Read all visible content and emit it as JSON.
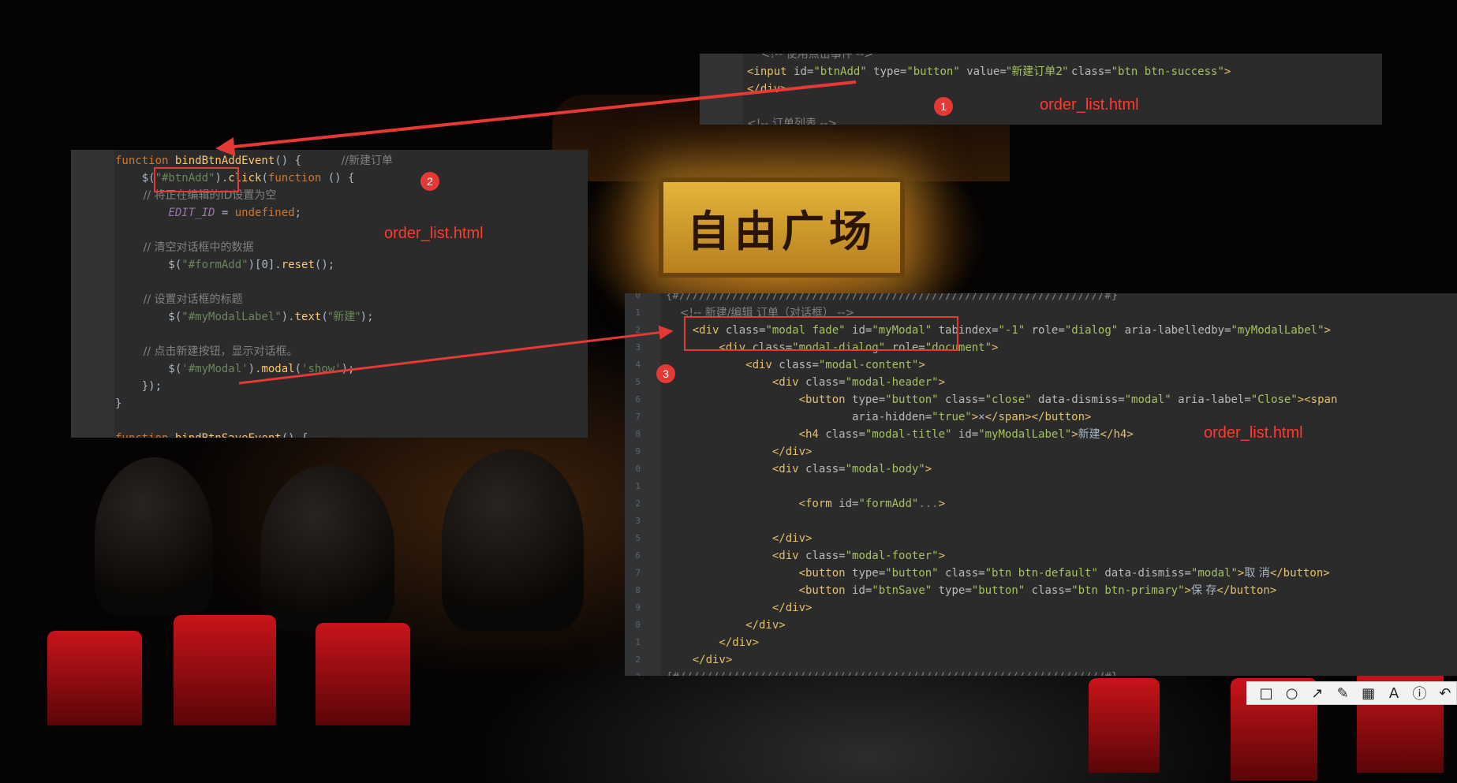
{
  "background": {
    "plaque_text": "自由广场"
  },
  "panel1": {
    "lines": [
      {
        "parts": [
          [
            "cm",
            "    <!-- 使用点击事件 -->"
          ]
        ]
      },
      {
        "parts": [
          [
            "tag",
            "<input "
          ],
          [
            "attr",
            "id="
          ],
          [
            "val",
            "\"btnAdd\" "
          ],
          [
            "attr",
            "type="
          ],
          [
            "val",
            "\"button\" "
          ],
          [
            "attr",
            "value="
          ],
          [
            "val",
            "\"新建订单2\" "
          ],
          [
            "attr",
            "class="
          ],
          [
            "val",
            "\"btn btn-success\""
          ],
          [
            "tag",
            ">"
          ]
        ]
      },
      {
        "parts": [
          [
            "tag",
            "</div>"
          ]
        ]
      },
      {
        "parts": [
          [
            "txt",
            " "
          ]
        ]
      },
      {
        "parts": [
          [
            "cm",
            "<!-- 订单列表 -->"
          ]
        ]
      }
    ]
  },
  "panel2": {
    "lines": [
      {
        "parts": [
          [
            "kw",
            "function "
          ],
          [
            "fn",
            "bindBtnAddEvent"
          ],
          [
            "txt",
            "() {      "
          ],
          [
            "cm",
            "//新建订单"
          ]
        ]
      },
      {
        "parts": [
          [
            "txt",
            "    $("
          ],
          [
            "str",
            "\"#btnAdd\""
          ],
          [
            "txt",
            ")."
          ],
          [
            "fn",
            "click"
          ],
          [
            "txt",
            "("
          ],
          [
            "kw",
            "function "
          ],
          [
            "txt",
            "() {"
          ]
        ]
      },
      {
        "parts": [
          [
            "cm",
            "        // 将正在编辑的ID设置为空"
          ]
        ]
      },
      {
        "parts": [
          [
            "var",
            "        EDIT_ID"
          ],
          [
            "txt",
            " = "
          ],
          [
            "kw",
            "undefined"
          ],
          [
            "txt",
            ";"
          ]
        ]
      },
      {
        "parts": [
          [
            "txt",
            " "
          ]
        ]
      },
      {
        "parts": [
          [
            "cm",
            "        // 清空对话框中的数据"
          ]
        ]
      },
      {
        "parts": [
          [
            "txt",
            "        $("
          ],
          [
            "str",
            "\"#formAdd\""
          ],
          [
            "txt",
            ")[0]."
          ],
          [
            "fn",
            "reset"
          ],
          [
            "txt",
            "();"
          ]
        ]
      },
      {
        "parts": [
          [
            "txt",
            " "
          ]
        ]
      },
      {
        "parts": [
          [
            "cm",
            "        // 设置对话框的标题"
          ]
        ]
      },
      {
        "parts": [
          [
            "txt",
            "        $("
          ],
          [
            "str",
            "\"#myModalLabel\""
          ],
          [
            "txt",
            ")."
          ],
          [
            "fn",
            "text"
          ],
          [
            "txt",
            "("
          ],
          [
            "str",
            "\"新建\""
          ],
          [
            "txt",
            ");"
          ]
        ]
      },
      {
        "parts": [
          [
            "txt",
            " "
          ]
        ]
      },
      {
        "parts": [
          [
            "cm",
            "        // 点击新建按钮，显示对话框。"
          ]
        ]
      },
      {
        "parts": [
          [
            "txt",
            "        $("
          ],
          [
            "str",
            "'#myModal'"
          ],
          [
            "txt",
            ")."
          ],
          [
            "fn",
            "modal"
          ],
          [
            "txt",
            "("
          ],
          [
            "str",
            "'show'"
          ],
          [
            "txt",
            ");"
          ]
        ]
      },
      {
        "parts": [
          [
            "txt",
            "    });"
          ]
        ]
      },
      {
        "parts": [
          [
            "txt",
            "}"
          ]
        ]
      },
      {
        "parts": [
          [
            "txt",
            " "
          ]
        ]
      },
      {
        "parts": [
          [
            "kw",
            "function "
          ],
          [
            "fn",
            "bindBtnSaveEvent"
          ],
          [
            "txt",
            "() {"
          ]
        ]
      }
    ]
  },
  "panel3": {
    "gutter_numbers": [
      "0",
      "1",
      "2",
      "3",
      "4",
      "5",
      "6",
      "7",
      "8",
      "9",
      "0",
      "1",
      "2",
      "3",
      "5",
      "6",
      "7",
      "8",
      "9",
      "0",
      "1",
      "2",
      "3"
    ],
    "lines": [
      {
        "parts": [
          [
            "cm",
            "{#////////////////////////////////////////////////////////////////#}"
          ]
        ]
      },
      {
        "parts": [
          [
            "cm",
            "    <!-- 新建/编辑 订单（对话框） -->"
          ]
        ]
      },
      {
        "parts": [
          [
            "tag",
            "    <div "
          ],
          [
            "attr",
            "class="
          ],
          [
            "val",
            "\"modal fade\" "
          ],
          [
            "attr",
            "id="
          ],
          [
            "val",
            "\"myModal\" "
          ],
          [
            "attr",
            "tabindex="
          ],
          [
            "val",
            "\"-1\" "
          ],
          [
            "attr",
            "role="
          ],
          [
            "val",
            "\"dialog\" "
          ],
          [
            "attr",
            "aria-labelledby="
          ],
          [
            "val",
            "\"myModalLabel\""
          ],
          [
            "tag",
            ">"
          ]
        ]
      },
      {
        "parts": [
          [
            "tag",
            "        <div "
          ],
          [
            "attr",
            "class="
          ],
          [
            "val",
            "\"modal-dialog\" "
          ],
          [
            "attr",
            "role="
          ],
          [
            "val",
            "\"document\""
          ],
          [
            "tag",
            ">"
          ]
        ]
      },
      {
        "parts": [
          [
            "tag",
            "            <div "
          ],
          [
            "attr",
            "class="
          ],
          [
            "val",
            "\"modal-content\""
          ],
          [
            "tag",
            ">"
          ]
        ]
      },
      {
        "parts": [
          [
            "tag",
            "                <div "
          ],
          [
            "attr",
            "class="
          ],
          [
            "val",
            "\"modal-header\""
          ],
          [
            "tag",
            ">"
          ]
        ]
      },
      {
        "parts": [
          [
            "tag",
            "                    <button "
          ],
          [
            "attr",
            "type="
          ],
          [
            "val",
            "\"button\" "
          ],
          [
            "attr",
            "class="
          ],
          [
            "val",
            "\"close\" "
          ],
          [
            "attr",
            "data-dismiss="
          ],
          [
            "val",
            "\"modal\" "
          ],
          [
            "attr",
            "aria-label="
          ],
          [
            "val",
            "\"Close\""
          ],
          [
            "tag",
            "><span"
          ]
        ]
      },
      {
        "parts": [
          [
            "attr",
            "                            aria-hidden="
          ],
          [
            "val",
            "\"true\""
          ],
          [
            "tag",
            ">"
          ],
          [
            "txt",
            "×"
          ],
          [
            "tag",
            "</span></button>"
          ]
        ]
      },
      {
        "parts": [
          [
            "tag",
            "                    <h4 "
          ],
          [
            "attr",
            "class="
          ],
          [
            "val",
            "\"modal-title\" "
          ],
          [
            "attr",
            "id="
          ],
          [
            "val",
            "\"myModalLabel\""
          ],
          [
            "tag",
            ">"
          ],
          [
            "txt",
            "新建"
          ],
          [
            "tag",
            "</h4>"
          ]
        ]
      },
      {
        "parts": [
          [
            "tag",
            "                </div>"
          ]
        ]
      },
      {
        "parts": [
          [
            "tag",
            "                <div "
          ],
          [
            "attr",
            "class="
          ],
          [
            "val",
            "\"modal-body\""
          ],
          [
            "tag",
            ">"
          ]
        ]
      },
      {
        "parts": [
          [
            "txt",
            " "
          ]
        ]
      },
      {
        "parts": [
          [
            "tag",
            "                    <form "
          ],
          [
            "attr",
            "id="
          ],
          [
            "val",
            "\"formAdd\""
          ],
          [
            "cm",
            "..."
          ],
          [
            "tag",
            ">"
          ]
        ]
      },
      {
        "parts": [
          [
            "txt",
            " "
          ]
        ]
      },
      {
        "parts": [
          [
            "tag",
            "                </div>"
          ]
        ]
      },
      {
        "parts": [
          [
            "tag",
            "                <div "
          ],
          [
            "attr",
            "class="
          ],
          [
            "val",
            "\"modal-footer\""
          ],
          [
            "tag",
            ">"
          ]
        ]
      },
      {
        "parts": [
          [
            "tag",
            "                    <button "
          ],
          [
            "attr",
            "type="
          ],
          [
            "val",
            "\"button\" "
          ],
          [
            "attr",
            "class="
          ],
          [
            "val",
            "\"btn btn-default\" "
          ],
          [
            "attr",
            "data-dismiss="
          ],
          [
            "val",
            "\"modal\""
          ],
          [
            "tag",
            ">"
          ],
          [
            "txt",
            "取 消"
          ],
          [
            "tag",
            "</button>"
          ]
        ]
      },
      {
        "parts": [
          [
            "tag",
            "                    <button "
          ],
          [
            "attr",
            "id="
          ],
          [
            "val",
            "\"btnSave\" "
          ],
          [
            "attr",
            "type="
          ],
          [
            "val",
            "\"button\" "
          ],
          [
            "attr",
            "class="
          ],
          [
            "val",
            "\"btn btn-primary\""
          ],
          [
            "tag",
            ">"
          ],
          [
            "txt",
            "保 存"
          ],
          [
            "tag",
            "</button>"
          ]
        ]
      },
      {
        "parts": [
          [
            "tag",
            "                </div>"
          ]
        ]
      },
      {
        "parts": [
          [
            "tag",
            "            </div>"
          ]
        ]
      },
      {
        "parts": [
          [
            "tag",
            "        </div>"
          ]
        ]
      },
      {
        "parts": [
          [
            "tag",
            "    </div>"
          ]
        ]
      },
      {
        "parts": [
          [
            "cm",
            "{#////////////////////////////////////////////////////////////////#}"
          ]
        ]
      }
    ]
  },
  "annotations": {
    "badge1": "1",
    "badge2": "2",
    "badge3": "3",
    "label1": "order_list.html",
    "label2": "order_list.html",
    "label3": "order_list.html",
    "arrow_color": "#e53935"
  },
  "toolbar": {
    "tools": [
      {
        "name": "rectangle-tool-icon",
        "glyph": "□"
      },
      {
        "name": "ellipse-tool-icon",
        "glyph": "○"
      },
      {
        "name": "arrow-tool-icon",
        "glyph": "↗"
      },
      {
        "name": "pen-tool-icon",
        "glyph": "✎"
      },
      {
        "name": "mosaic-tool-icon",
        "glyph": "▦"
      },
      {
        "name": "text-tool-icon",
        "glyph": "A"
      },
      {
        "name": "number-tool-icon",
        "glyph": "ⓘ"
      },
      {
        "name": "undo-tool-icon",
        "glyph": "↶"
      }
    ]
  }
}
